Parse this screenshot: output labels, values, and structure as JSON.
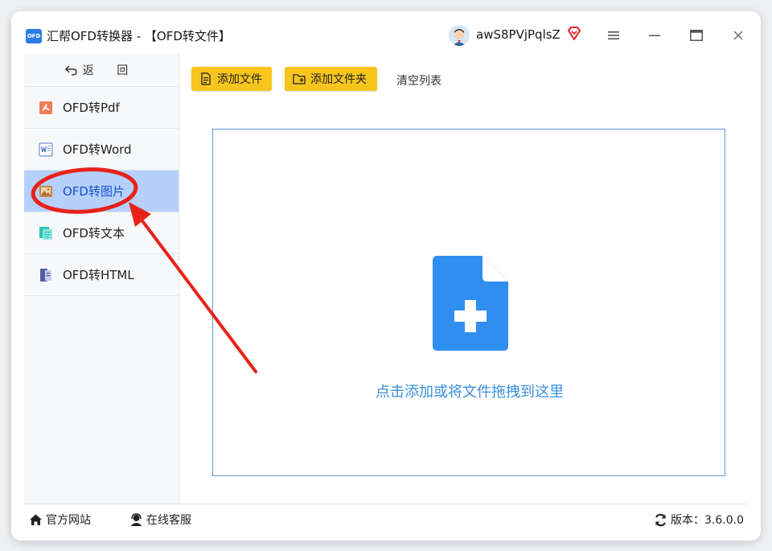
{
  "window": {
    "title": "汇帮OFD转换器 - 【OFD转文件】",
    "logo_text": "OFD",
    "username": "awS8PVjPqlsZ"
  },
  "sidebar": {
    "back_label": "返  回",
    "items": [
      {
        "label": "OFD转Pdf",
        "icon": "pdf-icon",
        "active": false
      },
      {
        "label": "OFD转Word",
        "icon": "word-icon",
        "active": false
      },
      {
        "label": "OFD转图片",
        "icon": "image-icon",
        "active": true
      },
      {
        "label": "OFD转文本",
        "icon": "text-icon",
        "active": false
      },
      {
        "label": "OFD转HTML",
        "icon": "html-icon",
        "active": false
      }
    ]
  },
  "toolbar": {
    "add_file_label": "添加文件",
    "add_folder_label": "添加文件夹",
    "clear_label": "清空列表"
  },
  "dropzone": {
    "text": "点击添加或将文件拖拽到这里"
  },
  "statusbar": {
    "website_label": "官方网站",
    "support_label": "在线客服",
    "version_label": "版本：3.6.0.0"
  },
  "colors": {
    "accent_yellow": "#f7c51e",
    "active_item_bg": "#b4d0fb",
    "drop_blue": "#2f8ef0",
    "annotation_red": "#e8221a"
  }
}
